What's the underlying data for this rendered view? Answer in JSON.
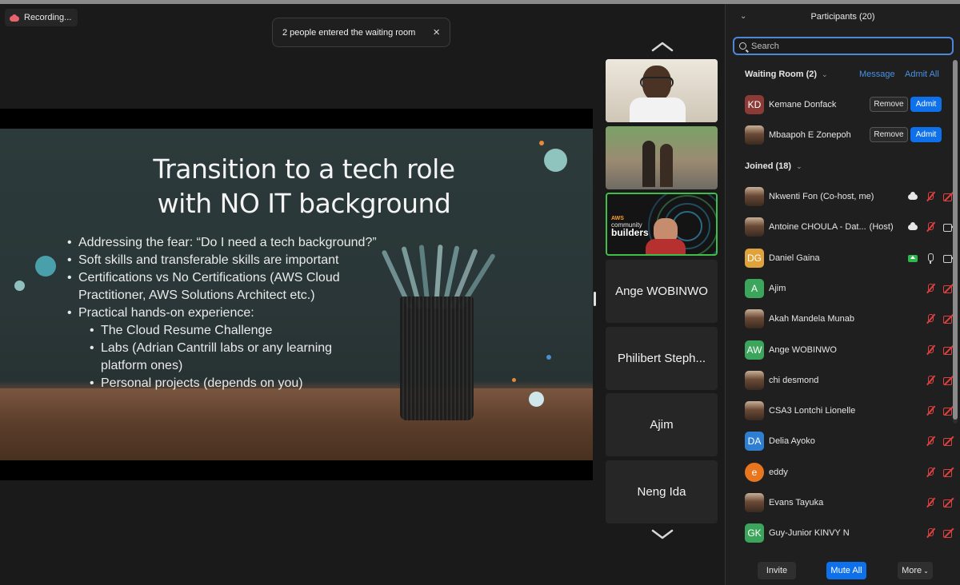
{
  "recording": {
    "label": "Recording..."
  },
  "toast": {
    "message": "2 people entered the waiting room",
    "close_icon": "×"
  },
  "slide": {
    "title_line1": "Transition to a tech role",
    "title_line2": "with NO IT background",
    "bullets": [
      {
        "level": 1,
        "text": "Addressing the fear: “Do I need a tech background?”"
      },
      {
        "level": 1,
        "text": "Soft skills and transferable skills are important"
      },
      {
        "level": 1,
        "text": "Certifications vs No Certifications (AWS Cloud"
      },
      {
        "level": 1,
        "text": "Practitioner, AWS Solutions Architect etc.)",
        "continuation": true
      },
      {
        "level": 1,
        "text": "Practical hands-on experience:"
      },
      {
        "level": 2,
        "text": "The Cloud Resume Challenge"
      },
      {
        "level": 2,
        "text": "Labs (Adrian Cantrill labs or any learning"
      },
      {
        "level": 2,
        "text": "platform ones)",
        "continuation": true
      },
      {
        "level": 2,
        "text": "Personal projects (depends on you)"
      }
    ]
  },
  "filmstrip": {
    "tiles": [
      {
        "label": "Ange WOBINWO"
      },
      {
        "label": "Philibert Steph..."
      },
      {
        "label": "Ajim"
      },
      {
        "label": "Neng Ida"
      }
    ],
    "aws_tile": {
      "line1": "AWS",
      "line2": "community",
      "line3": "builders"
    }
  },
  "panel": {
    "title": "Participants (20)",
    "search_placeholder": "Search",
    "waiting_room": {
      "label": "Waiting Room (2)",
      "message_link": "Message",
      "admit_all_link": "Admit All",
      "people": [
        {
          "initials": "KD",
          "name": "Kemane Donfack",
          "color": "#8b3a35",
          "remove": "Remove",
          "admit": "Admit"
        },
        {
          "initials": "",
          "name": "Mbaapoh E Zonepoh",
          "color": "",
          "remove": "Remove",
          "admit": "Admit"
        }
      ]
    },
    "joined": {
      "label": "Joined (18)",
      "people": [
        {
          "name": "Nkwenti Fon (Co-host, me)",
          "initials": "",
          "color": ""
        },
        {
          "name": "Antoine CHOULA - Dat...",
          "suffix": "(Host)",
          "initials": "",
          "color": ""
        },
        {
          "name": "Daniel Gaina",
          "initials": "DG",
          "color": "#e0a23b"
        },
        {
          "name": "Ajim",
          "initials": "A",
          "color": "#3ba55c"
        },
        {
          "name": "Akah Mandela Munab",
          "initials": "",
          "color": ""
        },
        {
          "name": "Ange WOBINWO",
          "initials": "AW",
          "color": "#3ba55c"
        },
        {
          "name": "chi desmond",
          "initials": "",
          "color": ""
        },
        {
          "name": "CSA3 Lontchi Lionelle",
          "initials": "",
          "color": ""
        },
        {
          "name": "Delia Ayoko",
          "initials": "DA",
          "color": "#2e7fd2"
        },
        {
          "name": "eddy",
          "initials": "e",
          "color": "#e8761f"
        },
        {
          "name": "Evans Tayuka",
          "initials": "",
          "color": ""
        },
        {
          "name": "Guy-Junior KINVY N",
          "initials": "GK",
          "color": "#3ba55c"
        }
      ]
    },
    "footer": {
      "invite": "Invite",
      "mute_all": "Mute All",
      "more": "More"
    }
  }
}
